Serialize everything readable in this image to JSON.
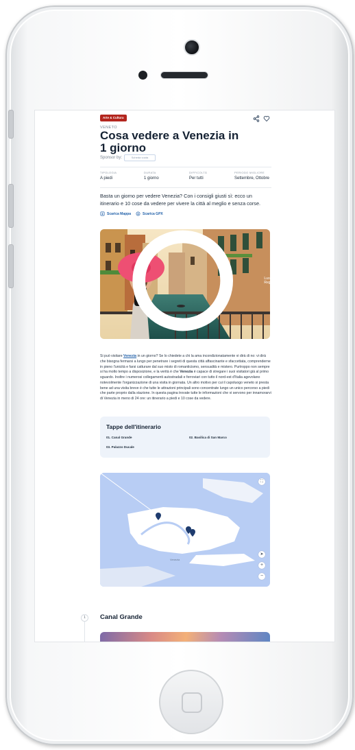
{
  "article": {
    "category_tag": "Arte & Cultura",
    "region": "VENETO",
    "title": "Cosa vedere a Venezia in 1 giorno",
    "sponsor_label": "Sponsor by:",
    "sponsor_placeholder": "Scheda vuota",
    "facts": [
      {
        "label": "TIPOLOGIA",
        "value": "A piedi"
      },
      {
        "label": "DURATA",
        "value": "1 giorno"
      },
      {
        "label": "DIFFICOLTÀ",
        "value": "Per tutti"
      },
      {
        "label": "PERIODO MIGLIORE",
        "value": "Settembre, Ottobre"
      }
    ],
    "intro": "Basta un giorno per vedere Venezia? Con i consigli giusti sì: ecco un itinerario e 10 cose da vedere per vivere la città al meglio e senza corse.",
    "download_map": "Scarica Mappa",
    "download_gpx": "Scarica GPX",
    "photo_caption": "Luogo: Regione",
    "body_text_1": "Si può visitare ",
    "body_link": "Venezia",
    "body_text_2": " in un giorno? Se lo chiedete a chi la ama incondizionatamente vi dirà di no: vi dirà che bisogna fermarsi a lungo per penetrare i segreti di questa città affascinante e sfaccettata, comprenderne in pieno l'unicità e farsi catturare dal suo misto di romanticismo, sensualità e mistero. Purtroppo non sempre si ha molto tempo a disposizione, e la verità è che ",
    "body_bold": "Venezia",
    "body_text_3": " è capace di stregare i suoi visitatori già al primo sguardo. Inoltre i numerosi collegamenti autostradali e ferroviari con tutto il nord-est d'Italia agevolano notevolmente l'organizzazione di una visita in giornata. Un altro motivo per cui il capoluogo veneto si presta bene ad una visita breve è che tutte le attrazioni principali sono concentrate lungo un unico percorso a piedi che parte proprio dalla stazione. In questa pagina trovate tutte le informazioni che vi servono per innamorarvi di Venezia in meno di 24 ore: un itinerario a piedi e 10 cose da vedere."
  },
  "stops": {
    "title": "Tappe dell'itinerario",
    "items": [
      "01. Canal Grande",
      "02. Basilica di San Marco",
      "03. Palazzo Ducale"
    ]
  },
  "map": {
    "label": "Venezia",
    "zoom_in": "+",
    "zoom_out": "−"
  },
  "stage": {
    "number": "1",
    "title": "Canal Grande"
  },
  "colors": {
    "tag": "#b3261e",
    "link": "#1f5fa8",
    "water": "#b8cdf4",
    "land": "#ffffff",
    "stops_bg": "#eef3fa"
  },
  "icons": [
    "share-icon",
    "heart-icon",
    "map-download-icon",
    "gpx-download-icon",
    "location-icon",
    "fullscreen-icon",
    "locate-icon",
    "map-pin-icon"
  ]
}
